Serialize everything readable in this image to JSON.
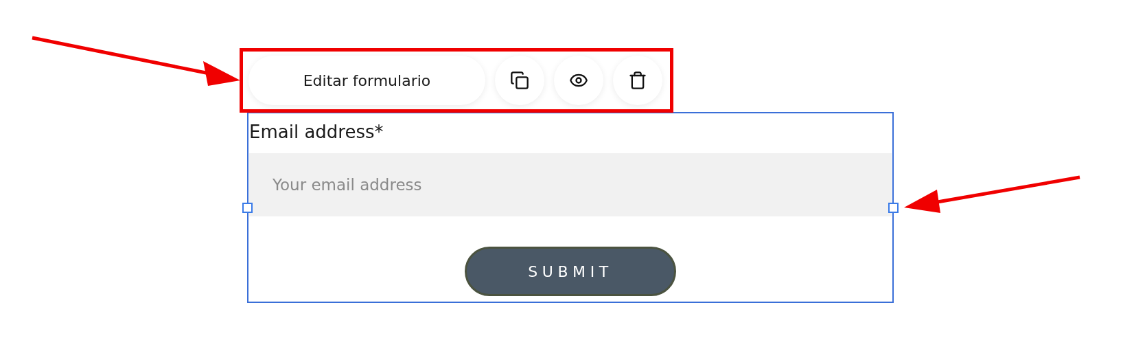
{
  "toolbar": {
    "edit_button": "Editar formulario"
  },
  "form": {
    "label": "Email address*",
    "email_field": {
      "placeholder": "Your email address"
    },
    "submit_button": "SUBMIT"
  }
}
